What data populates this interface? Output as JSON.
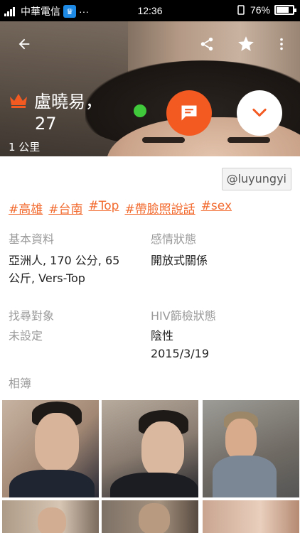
{
  "status_bar": {
    "carrier": "中華電信",
    "network": "HD",
    "extra": "···",
    "time": "12:36",
    "battery_text": "76%",
    "battery_level": 0.76
  },
  "topbar": {
    "back_icon": "arrow-left-icon",
    "share_icon": "share-icon",
    "favorite_icon": "star-icon",
    "more_icon": "more-vert-icon"
  },
  "profile": {
    "name": "盧曉易，",
    "age": "27",
    "distance": "1 公里",
    "online": true,
    "handle": "@luyungyi",
    "tags": [
      "#高雄",
      "#台南",
      "#Top",
      "#帶臉照說話",
      "#sex"
    ]
  },
  "fields": {
    "basic_label": "基本資料",
    "basic_value_line1": "亞洲人, 170 公分, 65",
    "basic_value_line2": "公斤, Vers-Top",
    "relationship_label": "感情狀態",
    "relationship_value": "開放式關係",
    "looking_label": "找尋對象",
    "looking_value": "未設定",
    "hiv_label": "HIV篩檢狀態",
    "hiv_value": "陰性",
    "hiv_date": "2015/3/19"
  },
  "album": {
    "label": "相簿"
  },
  "colors": {
    "accent": "#f35a22",
    "tag": "#f26a2e",
    "online": "#3fc93b",
    "label": "#9a9a9a"
  }
}
